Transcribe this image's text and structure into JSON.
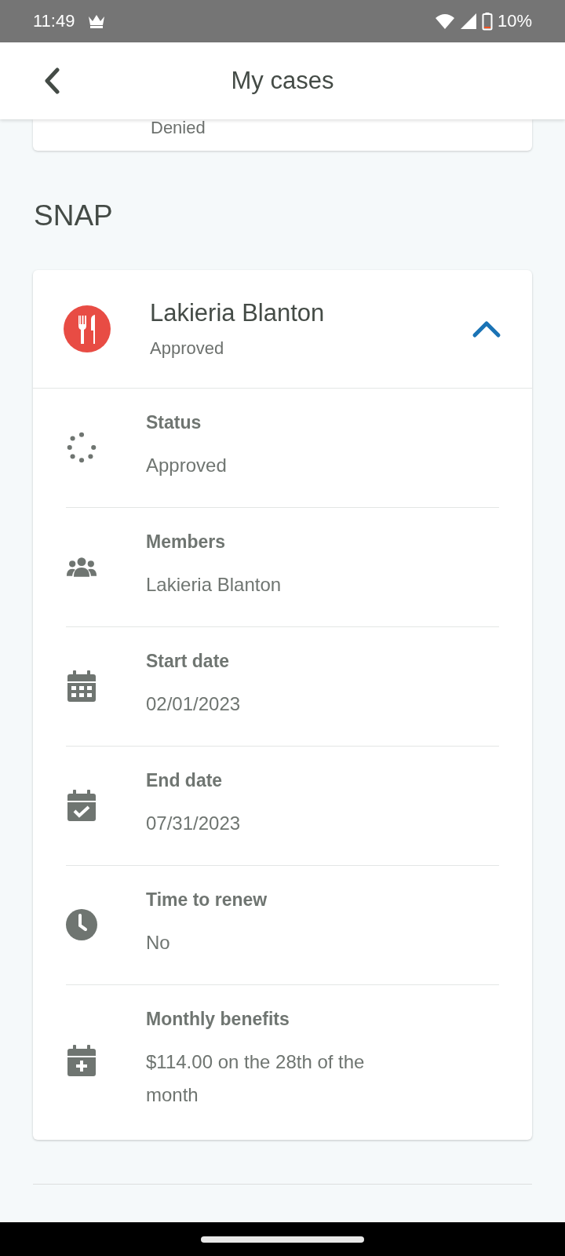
{
  "status_bar": {
    "time": "11:49",
    "battery": "10%"
  },
  "header": {
    "title": "My cases"
  },
  "previous_card": {
    "status": "Denied"
  },
  "section": {
    "title": "SNAP"
  },
  "case": {
    "name": "Lakieria Blanton",
    "status": "Approved",
    "expanded": true,
    "details": [
      {
        "kind": "status",
        "label": "Status",
        "value": "Approved"
      },
      {
        "kind": "members",
        "label": "Members",
        "value": "Lakieria Blanton"
      },
      {
        "kind": "start",
        "label": "Start date",
        "value": "02/01/2023"
      },
      {
        "kind": "end",
        "label": "End date",
        "value": "07/31/2023"
      },
      {
        "kind": "renew",
        "label": "Time to renew",
        "value": "No"
      },
      {
        "kind": "benefits",
        "label": "Monthly benefits",
        "value": "$114.00 on the 28th of the month"
      }
    ]
  }
}
